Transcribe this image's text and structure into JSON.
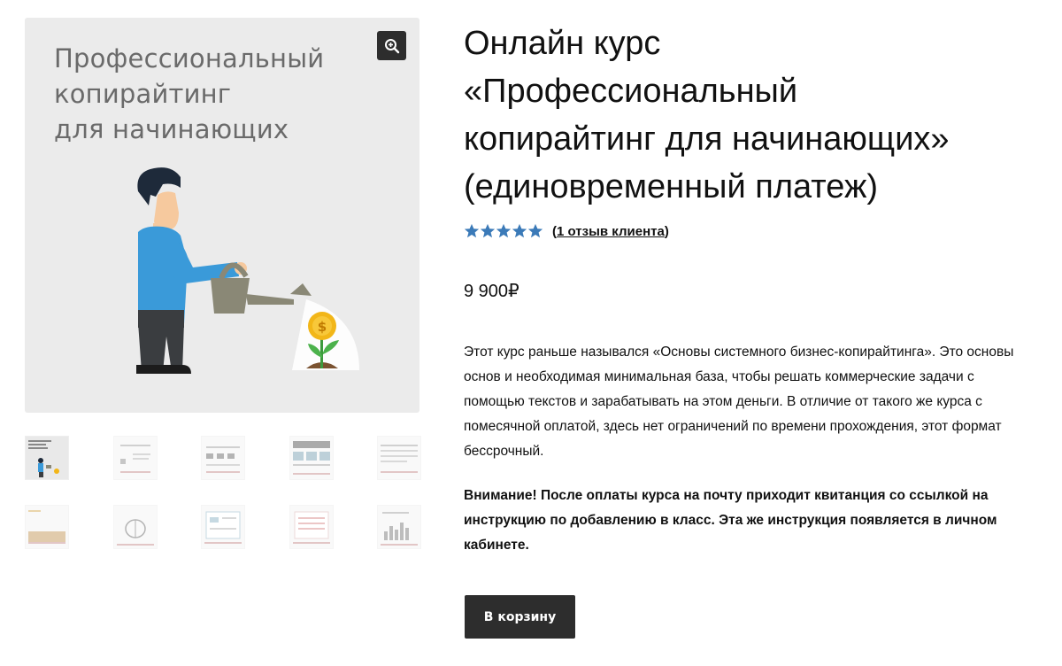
{
  "gallery": {
    "main_image": {
      "title_lines": [
        "Профессиональный",
        "копирайтинг",
        "для начинающих"
      ],
      "currency_symbol": "$"
    },
    "zoom_icon": "zoom-in-icon",
    "thumbnails": [
      {
        "label": "course-cover"
      },
      {
        "label": "slide-2"
      },
      {
        "label": "slide-3"
      },
      {
        "label": "slide-4"
      },
      {
        "label": "slide-5"
      },
      {
        "label": "slide-6"
      },
      {
        "label": "slide-7"
      },
      {
        "label": "slide-8"
      },
      {
        "label": "slide-9"
      },
      {
        "label": "slide-10"
      }
    ]
  },
  "product": {
    "title_lines": [
      "Онлайн курс",
      "«Профессиональный",
      "копирайтинг для начинающих»",
      "(единовременный платеж)"
    ],
    "rating": {
      "stars": 5,
      "max": 5,
      "color": "#3b7ab8"
    },
    "reviews_prefix": "(",
    "reviews_link": "1 отзыв клиента",
    "reviews_suffix": ")",
    "price": "9 900₽",
    "description": "Этот курс раньше назывался «Основы системного бизнес-копирайтинга». Это основы основ и необходимая минимальная база, чтобы решать коммерческие задачи с помощью текстов и зарабатывать на этом деньги. В отличие от такого же курса с помесячной оплатой, здесь нет ограничений по времени прохождения, этот формат бессрочный.",
    "notice": "Внимание! После оплаты курса на почту приходит квитанция со ссылкой на инструкцию по добавлению в класс. Эта же инструкция появляется в личном кабинете.",
    "add_to_cart": "В корзину"
  },
  "colors": {
    "button_bg": "#2d2d2d",
    "star": "#3b7ab8",
    "image_bg": "#ebebeb"
  }
}
